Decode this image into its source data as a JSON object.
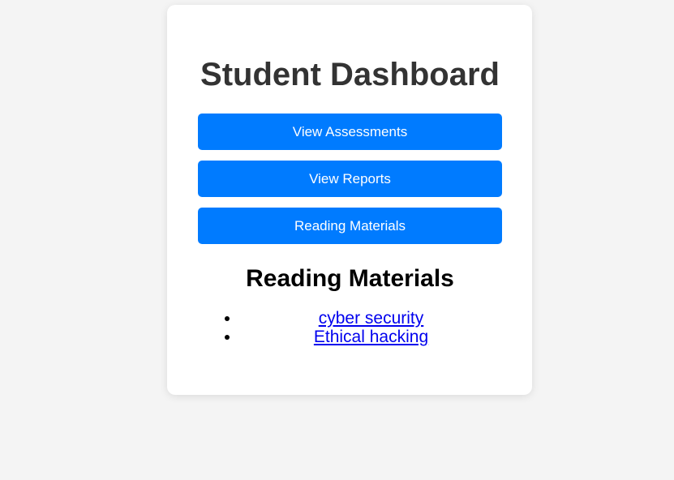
{
  "dashboard": {
    "title": "Student Dashboard",
    "buttons": {
      "assessments": "View Assessments",
      "reports": "View Reports",
      "reading": "Reading Materials"
    }
  },
  "reading_section": {
    "title": "Reading Materials",
    "items": [
      {
        "label": "cyber security"
      },
      {
        "label": "Ethical hacking"
      }
    ]
  },
  "colors": {
    "page_background": "#f4f4f4",
    "card_background": "#ffffff",
    "button_primary": "#007bff",
    "title_text": "#333333",
    "link": "#0000ee"
  }
}
